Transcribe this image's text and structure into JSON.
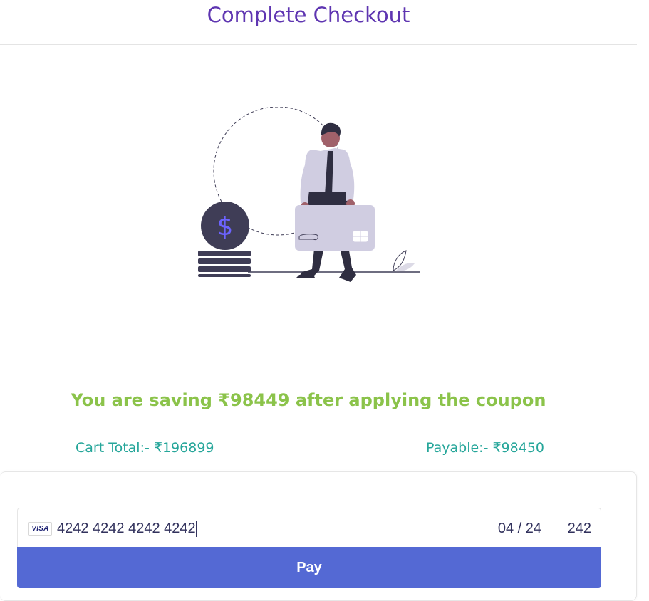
{
  "header": {
    "title": "Complete Checkout"
  },
  "summary": {
    "savings_text": "You are saving ₹98449 after applying the coupon",
    "cart_total": "Cart Total:- ₹196899",
    "payable": "Payable:- ₹98450"
  },
  "payment": {
    "card_brand": "VISA",
    "card_number": "4242 4242 4242 4242",
    "expiry": "04 / 24",
    "cvc": "242",
    "pay_label": "Pay"
  },
  "colors": {
    "title": "#5e35b1",
    "savings": "#8bc34a",
    "totals": "#26a69a",
    "pay_button": "#5469d4"
  }
}
